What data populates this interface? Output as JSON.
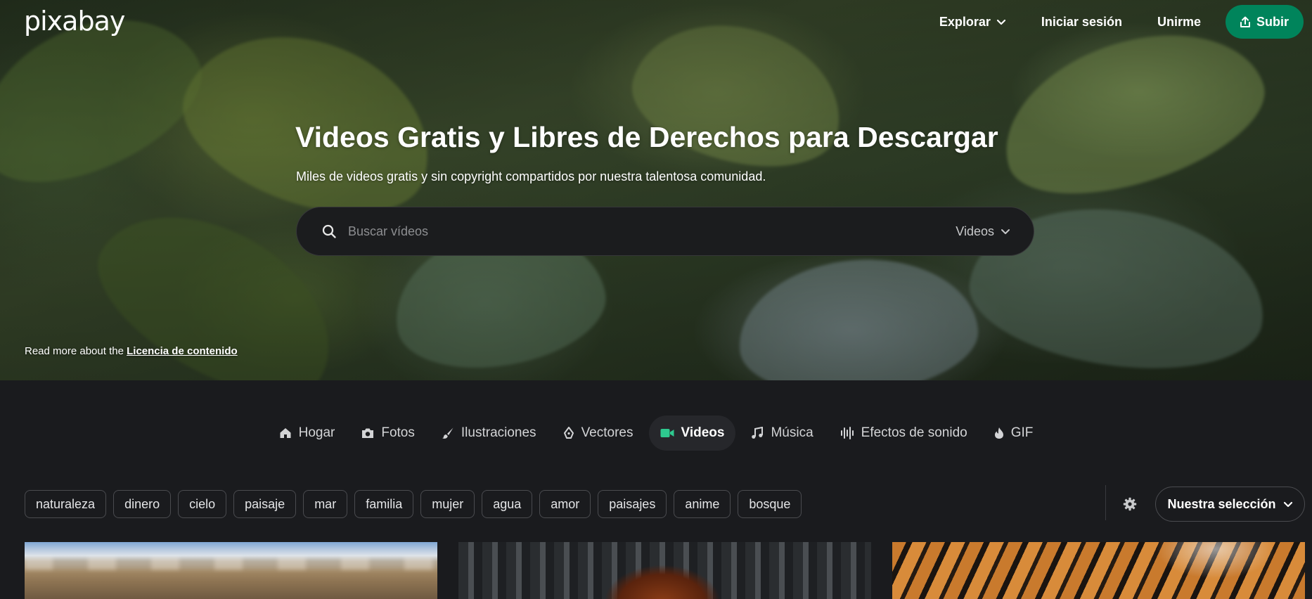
{
  "brand": {
    "logo_text": "pixabay"
  },
  "header": {
    "explore_label": "Explorar",
    "login_label": "Iniciar sesión",
    "join_label": "Unirme",
    "upload_label": "Subir"
  },
  "hero": {
    "title": "Videos Gratis y Libres de Derechos para Descargar",
    "subtitle": "Miles de videos gratis y sin copyright compartidos por nuestra talentosa comunidad.",
    "search": {
      "placeholder": "Buscar vídeos",
      "value": "",
      "type_label": "Videos"
    },
    "license_prefix": "Read more about the",
    "license_link": "Licencia de contenido"
  },
  "categories": [
    {
      "label": "Hogar",
      "icon": "home-icon",
      "active": false
    },
    {
      "label": "Fotos",
      "icon": "camera-icon",
      "active": false
    },
    {
      "label": "Ilustraciones",
      "icon": "brush-icon",
      "active": false
    },
    {
      "label": "Vectores",
      "icon": "pen-nib-icon",
      "active": false
    },
    {
      "label": "Videos",
      "icon": "video-camera-icon",
      "active": true
    },
    {
      "label": "Música",
      "icon": "music-note-icon",
      "active": false
    },
    {
      "label": "Efectos de sonido",
      "icon": "sound-wave-icon",
      "active": false
    },
    {
      "label": "GIF",
      "icon": "flame-icon",
      "active": false
    }
  ],
  "tags": [
    "naturaleza",
    "dinero",
    "cielo",
    "paisaje",
    "mar",
    "familia",
    "mujer",
    "agua",
    "amor",
    "paisajes",
    "anime",
    "bosque"
  ],
  "sort": {
    "selected": "Nuestra selección"
  },
  "colors": {
    "accent": "#00845b",
    "active_icon": "#2ec98f",
    "background": "#1a1b1e"
  }
}
